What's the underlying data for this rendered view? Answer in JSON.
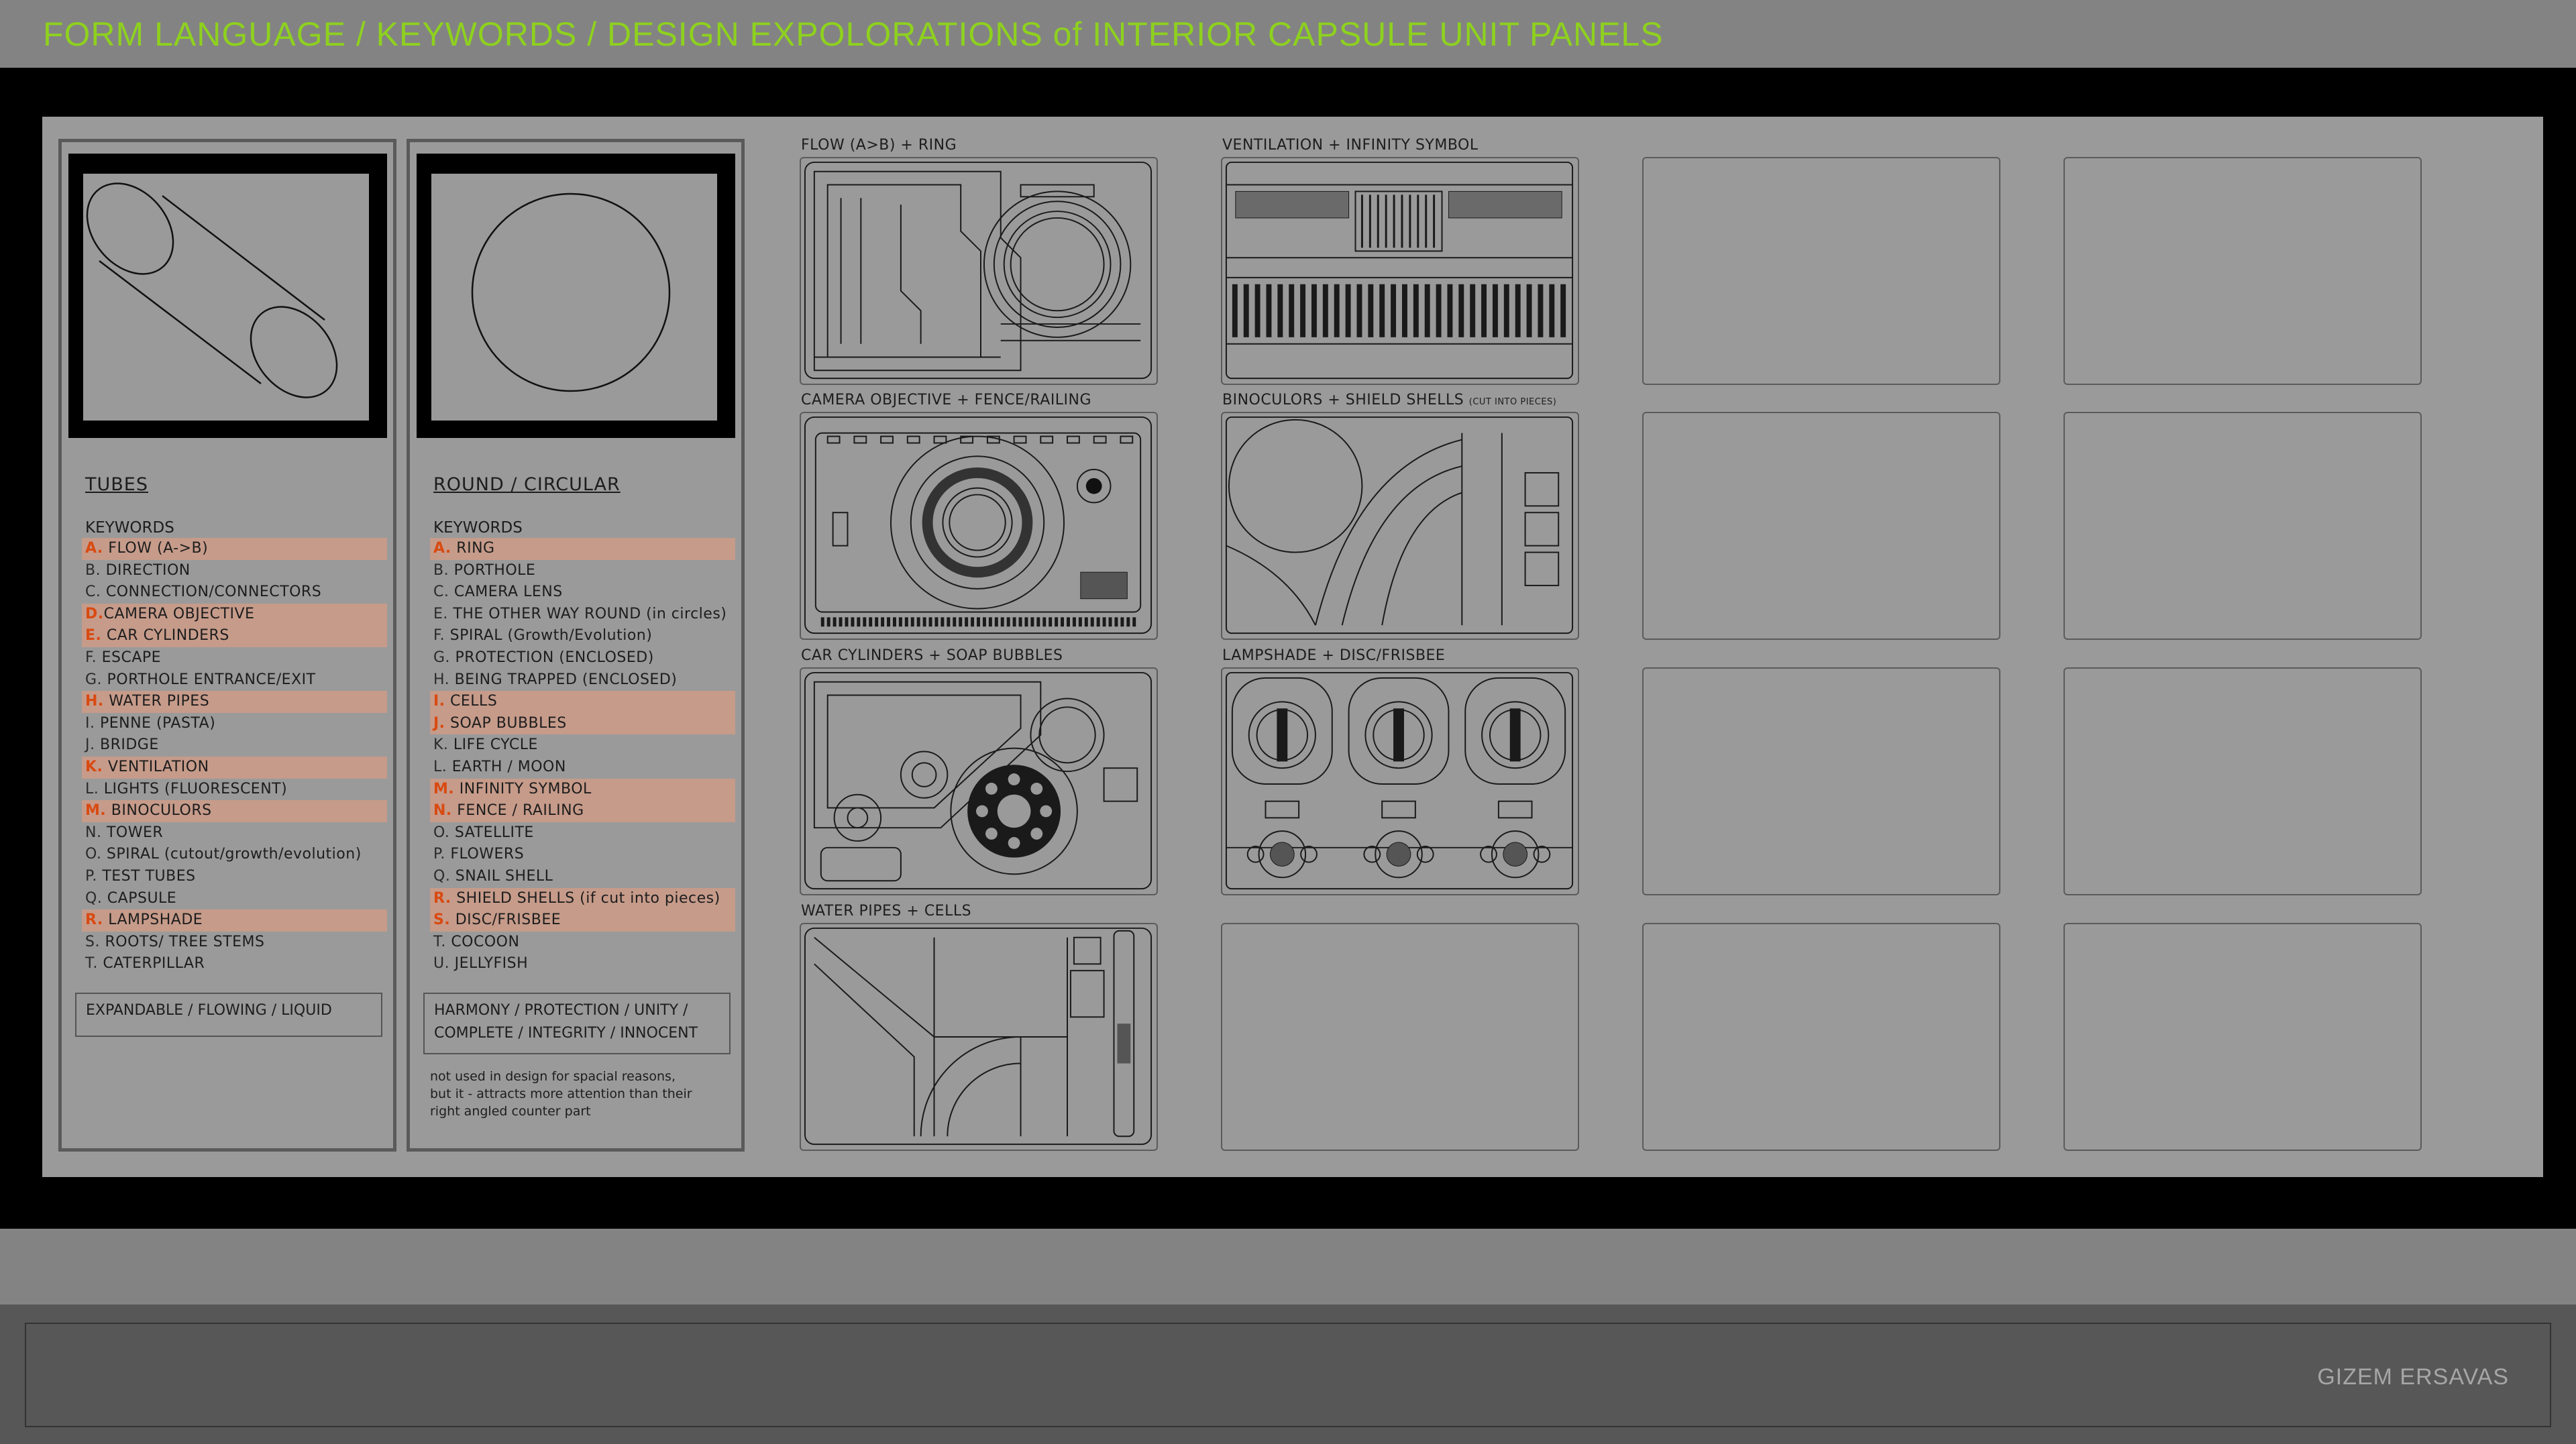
{
  "title": "FORM LANGUAGE / KEYWORDS / DESIGN EXPOLORATIONS of INTERIOR CAPSULE UNIT PANELS",
  "author": "GIZEM ERSAVAS",
  "colors": {
    "title": "#8ed11e",
    "highlight_bg": "#c69b8a",
    "highlight_letter": "#d94a11"
  },
  "columns": [
    {
      "name": "TUBES",
      "keywords_label": "KEYWORDS",
      "keywords": [
        {
          "letter": "A.",
          "text": " FLOW (A->B)",
          "highlighted": true
        },
        {
          "letter": "B.",
          "text": " DIRECTION",
          "highlighted": false
        },
        {
          "letter": "C.",
          "text": " CONNECTION/CONNECTORS",
          "highlighted": false
        },
        {
          "letter": "D.",
          "text": "CAMERA OBJECTIVE",
          "highlighted": true
        },
        {
          "letter": "E.",
          "text": " CAR CYLINDERS",
          "highlighted": true
        },
        {
          "letter": "F.",
          "text": " ESCAPE",
          "highlighted": false
        },
        {
          "letter": "G.",
          "text": " PORTHOLE ENTRANCE/EXIT",
          "highlighted": false
        },
        {
          "letter": "H.",
          "text": " WATER PIPES",
          "highlighted": true
        },
        {
          "letter": "I.",
          "text": " PENNE (PASTA)",
          "highlighted": false
        },
        {
          "letter": "J.",
          "text": " BRIDGE",
          "highlighted": false
        },
        {
          "letter": "K.",
          "text": " VENTILATION",
          "highlighted": true
        },
        {
          "letter": "L.",
          "text": " LIGHTS (FLUORESCENT)",
          "highlighted": false
        },
        {
          "letter": "M.",
          "text": " BINOCULORS",
          "highlighted": true
        },
        {
          "letter": "N.",
          "text": " TOWER",
          "highlighted": false
        },
        {
          "letter": "O.",
          "text": " SPIRAL (cutout/growth/evolution)",
          "highlighted": false
        },
        {
          "letter": "P.",
          "text": " TEST TUBES",
          "highlighted": false
        },
        {
          "letter": "Q.",
          "text": " CAPSULE",
          "highlighted": false
        },
        {
          "letter": "R.",
          "text": " LAMPSHADE",
          "highlighted": true
        },
        {
          "letter": "S.",
          "text": " ROOTS/ TREE STEMS",
          "highlighted": false
        },
        {
          "letter": "T.",
          "text": " CATERPILLAR",
          "highlighted": false
        }
      ],
      "summary": [
        "EXPANDABLE / FLOWING / LIQUID"
      ],
      "note": []
    },
    {
      "name": "ROUND / CIRCULAR",
      "keywords_label": "KEYWORDS",
      "keywords": [
        {
          "letter": "A.",
          "text": " RING",
          "highlighted": true
        },
        {
          "letter": "B.",
          "text": " PORTHOLE",
          "highlighted": false
        },
        {
          "letter": "C.",
          "text": " CAMERA LENS",
          "highlighted": false
        },
        {
          "letter": "E.",
          "text": " THE OTHER WAY ROUND (in circles)",
          "highlighted": false
        },
        {
          "letter": "F.",
          "text": " SPIRAL (Growth/Evolution)",
          "highlighted": false
        },
        {
          "letter": "G.",
          "text": " PROTECTION (ENCLOSED)",
          "highlighted": false
        },
        {
          "letter": "H.",
          "text": " BEING TRAPPED (ENCLOSED)",
          "highlighted": false
        },
        {
          "letter": "I.",
          "text": " CELLS",
          "highlighted": true
        },
        {
          "letter": "J.",
          "text": " SOAP BUBBLES",
          "highlighted": true
        },
        {
          "letter": "K.",
          "text": " LIFE CYCLE",
          "highlighted": false
        },
        {
          "letter": "L.",
          "text": " EARTH / MOON",
          "highlighted": false
        },
        {
          "letter": "M.",
          "text": " INFINITY SYMBOL",
          "highlighted": true
        },
        {
          "letter": "N.",
          "text": " FENCE / RAILING",
          "highlighted": true
        },
        {
          "letter": "O.",
          "text": " SATELLITE",
          "highlighted": false
        },
        {
          "letter": "P.",
          "text": " FLOWERS",
          "highlighted": false
        },
        {
          "letter": "Q.",
          "text": " SNAIL SHELL",
          "highlighted": false
        },
        {
          "letter": "R.",
          "text": " SHIELD SHELLS (if cut into pieces)",
          "highlighted": true
        },
        {
          "letter": "S.",
          "text": " DISC/FRISBEE",
          "highlighted": true
        },
        {
          "letter": "T.",
          "text": " COCOON",
          "highlighted": false
        },
        {
          "letter": "U.",
          "text": " JELLYFISH",
          "highlighted": false
        }
      ],
      "summary": [
        "HARMONY / PROTECTION / UNITY /",
        "COMPLETE / INTEGRITY / INNOCENT"
      ],
      "note": [
        "not used in design for spacial reasons,",
        "but it - attracts more attention than their",
        "right angled counter part"
      ]
    }
  ],
  "panels": [
    {
      "label": "FLOW (A>B) + RING",
      "sub": "",
      "icon": "flow-ring-panel"
    },
    {
      "label": "VENTILATION + INFINITY SYMBOL",
      "sub": "",
      "icon": "ventilation-panel"
    },
    {
      "label": "",
      "sub": "",
      "icon": "empty-panel"
    },
    {
      "label": "",
      "sub": "",
      "icon": "empty-panel"
    },
    {
      "label": "CAMERA OBJECTIVE + FENCE/RAILING",
      "sub": "",
      "icon": "camera-panel"
    },
    {
      "label": "BINOCULORS + SHIELD SHELLS",
      "sub": "(CUT INTO PIECES)",
      "icon": "binoculars-panel"
    },
    {
      "label": "",
      "sub": "",
      "icon": "empty-panel"
    },
    {
      "label": "",
      "sub": "",
      "icon": "empty-panel"
    },
    {
      "label": "CAR CYLINDERS + SOAP BUBBLES",
      "sub": "",
      "icon": "car-cylinders-panel"
    },
    {
      "label": "LAMPSHADE + DISC/FRISBEE",
      "sub": "",
      "icon": "lampshade-panel"
    },
    {
      "label": "",
      "sub": "",
      "icon": "empty-panel"
    },
    {
      "label": "",
      "sub": "",
      "icon": "empty-panel"
    },
    {
      "label": "WATER PIPES + CELLS",
      "sub": "",
      "icon": "water-pipes-panel"
    },
    {
      "label": "",
      "sub": "",
      "icon": "empty-panel"
    },
    {
      "label": "",
      "sub": "",
      "icon": "empty-panel"
    },
    {
      "label": "",
      "sub": "",
      "icon": "empty-panel"
    }
  ]
}
